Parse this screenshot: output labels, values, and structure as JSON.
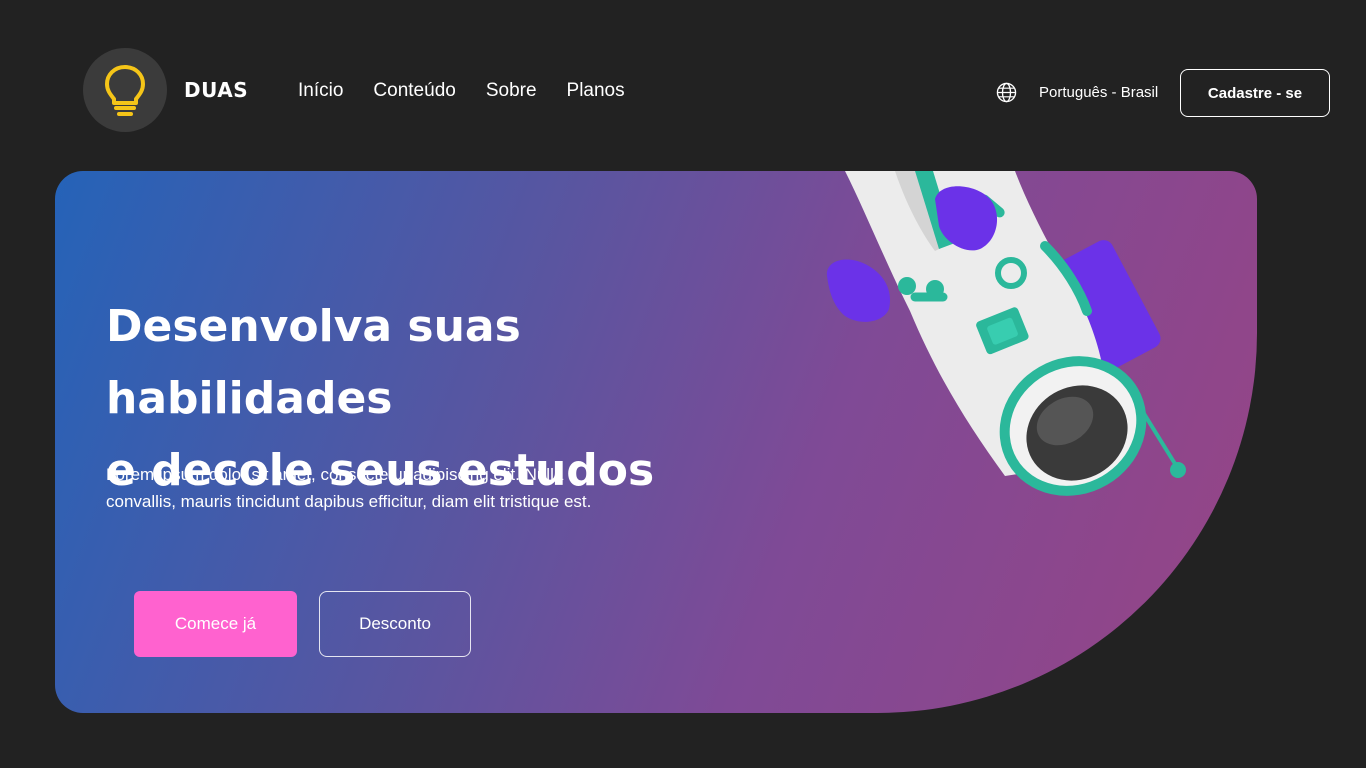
{
  "header": {
    "brand": "DUAS",
    "nav": [
      "Início",
      "Conteúdo",
      "Sobre",
      "Planos"
    ],
    "language": "Português - Brasil",
    "signup_label": "Cadastre - se",
    "logo_icon": "lightbulb-icon",
    "language_icon": "globe-icon"
  },
  "hero": {
    "title": "Desenvolva suas habilidades\ne decole seus estudos",
    "text": "Lorem ipsum dolor sit amet, consectetur adipiscing elit. Nulla convallis, mauris tincidunt dapibus efficitur, diam elit tristique est.",
    "primary_button": "Comece já",
    "secondary_button": "Desconto"
  },
  "colors": {
    "background": "#222222",
    "accent_pink": "#ff62cf",
    "logo_yellow": "#f5c518",
    "gradient_start": "#2563b8",
    "gradient_end": "#974485"
  }
}
